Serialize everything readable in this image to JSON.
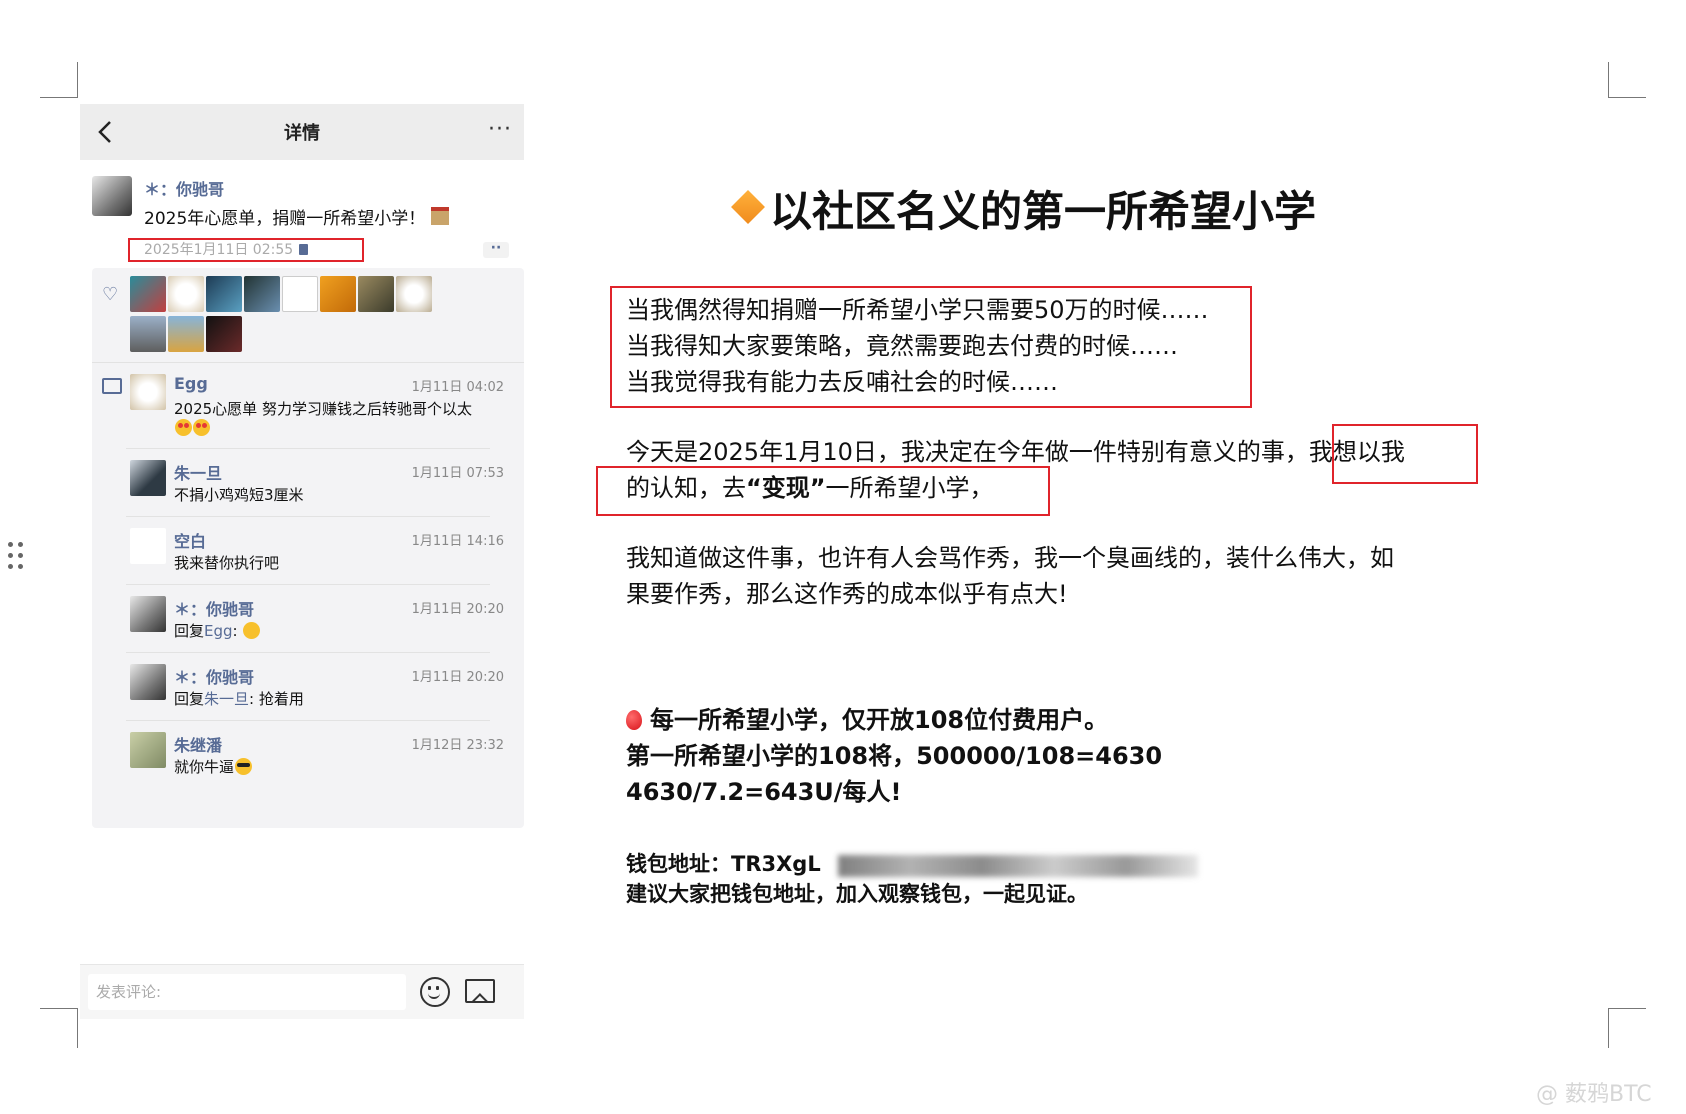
{
  "phone": {
    "header_title": "详情",
    "post": {
      "author": "＊：你驰哥",
      "text": "2025年心愿单，捐赠一所希望小学！",
      "time": "2025年1月11日 02:55"
    },
    "comments": [
      {
        "name": "Egg",
        "time": "1月11日 04:02",
        "text": "2025心愿单 努力学习赚钱之后转驰哥个以太",
        "emoji": "love"
      },
      {
        "name": "朱一旦",
        "time": "1月11日 07:53",
        "text": "不捐小鸡鸡短3厘米"
      },
      {
        "name": "空白",
        "time": "1月11日 14:16",
        "text": "我来替你执行吧"
      },
      {
        "name": "＊：你驰哥",
        "time": "1月11日 20:20",
        "reply_prefix": "回复",
        "reply_to": "Egg",
        "reply_suffix": ":",
        "emoji": "grin"
      },
      {
        "name": "＊：你驰哥",
        "time": "1月11日 20:20",
        "reply_prefix": "回复",
        "reply_to": "朱一旦",
        "reply_suffix": ": 抢着用"
      },
      {
        "name": "朱继潘",
        "time": "1月12日 23:32",
        "text": "就你牛逼",
        "emoji": "cool"
      }
    ],
    "input_placeholder": "发表评论:"
  },
  "doc": {
    "title": "以社区名义的第一所希望小学",
    "para1": [
      "当我偶然得知捐赠一所希望小学只需要50万的时候……",
      "当我得知大家要策略，竟然需要跑去付费的时候……",
      "当我觉得我有能力去反哺社会的时候……"
    ],
    "para2_line1_a": "今天是2025年1月10日，我决定在今年做一件特别有意义的事，",
    "para2_line1_b": "我想以我",
    "para2_line2_a": "的认知，去",
    "para2_line2_bold": "“变现”",
    "para2_line2_b": "一所希望小学，",
    "para3": [
      "我知道做这件事，也许有人会骂作秀，我一个臭画线的，装什么伟大，如",
      "果要作秀，那么这作秀的成本似乎有点大!"
    ],
    "para4": [
      "每一所希望小学，仅开放108位付费用户。",
      "第一所希望小学的108将，500000/108=4630",
      "4630/7.2=643U/每人!"
    ],
    "wallet_label": "钱包地址：TR3XgL",
    "wallet_note": "建议大家把钱包地址，加入观察钱包，一起见证。"
  },
  "watermark": "@ 薮鸦BTC"
}
